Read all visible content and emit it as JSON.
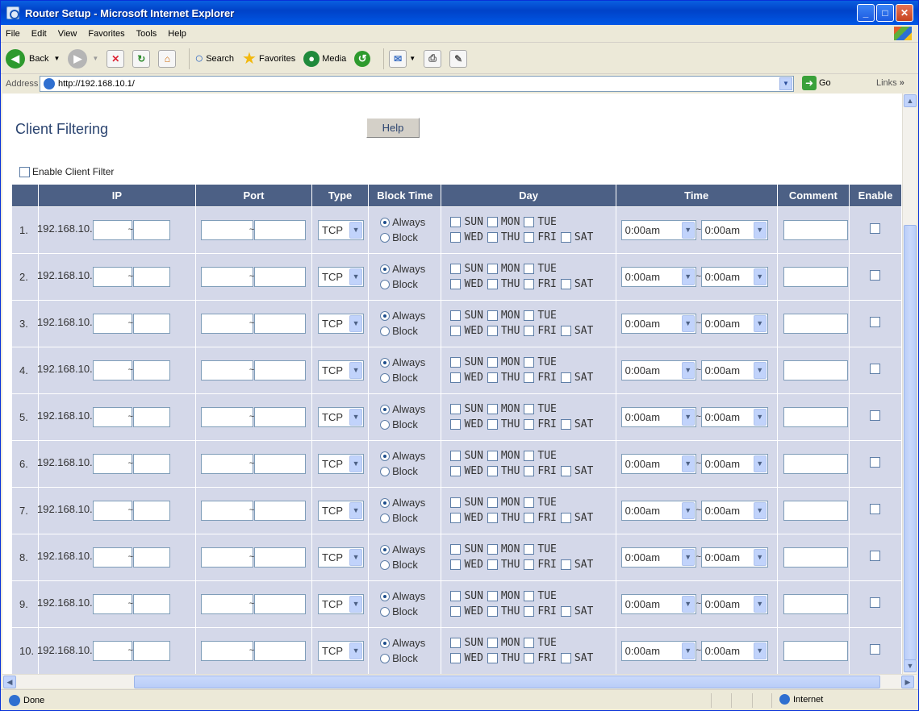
{
  "window": {
    "title": "Router Setup - Microsoft Internet Explorer"
  },
  "menu": [
    "File",
    "Edit",
    "View",
    "Favorites",
    "Tools",
    "Help"
  ],
  "toolbar": {
    "back": "Back",
    "search": "Search",
    "favorites": "Favorites",
    "media": "Media"
  },
  "address": {
    "label": "Address",
    "url": "http://192.168.10.1/",
    "go": "Go",
    "links": "Links"
  },
  "page": {
    "title": "Client Filtering",
    "help": "Help",
    "enable_label": "Enable Client Filter"
  },
  "table": {
    "headers": [
      "IP",
      "Port",
      "Type",
      "Block Time",
      "Day",
      "Time",
      "Comment",
      "Enable"
    ],
    "ip_prefix": "192.168.10.",
    "type_value": "TCP",
    "radio_always": "Always",
    "radio_block": "Block",
    "days_line1": [
      "SUN",
      "MON",
      "TUE"
    ],
    "days_line2": [
      "WED",
      "THU",
      "FRI",
      "SAT"
    ],
    "time_from": "0:00am",
    "time_to": "0:00am",
    "rows": [
      "1.",
      "2.",
      "3.",
      "4.",
      "5.",
      "6.",
      "7.",
      "8.",
      "9.",
      "10."
    ]
  },
  "status": {
    "text": "Done",
    "zone": "Internet"
  }
}
